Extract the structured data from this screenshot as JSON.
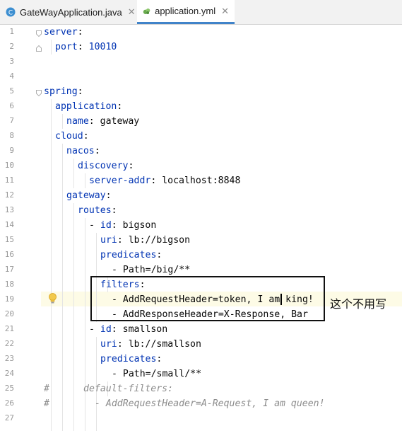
{
  "tabs": [
    {
      "label": "GateWayApplication.java",
      "icon": "java-class-icon",
      "active": false
    },
    {
      "label": "application.yml",
      "icon": "yaml-file-icon",
      "active": true
    }
  ],
  "line_numbers": [
    "1",
    "2",
    "3",
    "4",
    "5",
    "6",
    "7",
    "8",
    "9",
    "10",
    "11",
    "12",
    "13",
    "14",
    "15",
    "16",
    "17",
    "18",
    "19",
    "20",
    "21",
    "22",
    "23",
    "24",
    "25",
    "26",
    "27"
  ],
  "code": {
    "l1": {
      "key": "server",
      "sep": ":"
    },
    "l2": {
      "key": "port",
      "sep": ": ",
      "val": "10010"
    },
    "l5": {
      "key": "spring",
      "sep": ":"
    },
    "l6": {
      "key": "application",
      "sep": ":"
    },
    "l7": {
      "key": "name",
      "sep": ": ",
      "val": "gateway"
    },
    "l8": {
      "key": "cloud",
      "sep": ":"
    },
    "l9": {
      "key": "nacos",
      "sep": ":"
    },
    "l10": {
      "key": "discovery",
      "sep": ":"
    },
    "l11": {
      "key": "server-addr",
      "sep": ": ",
      "val": "localhost:8848"
    },
    "l12": {
      "key": "gateway",
      "sep": ":"
    },
    "l13": {
      "key": "routes",
      "sep": ":"
    },
    "l14": {
      "dash": "- ",
      "key": "id",
      "sep": ": ",
      "val": "bigson"
    },
    "l15": {
      "key": "uri",
      "sep": ": ",
      "val": "lb://bigson"
    },
    "l16": {
      "key": "predicates",
      "sep": ":"
    },
    "l17": {
      "dash": "- ",
      "val": "Path=/big/**"
    },
    "l18": {
      "key": "filters",
      "sep": ":"
    },
    "l19": {
      "dash": "- ",
      "val": "AddRequestHeader=token, I am king!"
    },
    "l20": {
      "dash": "- ",
      "val": "AddResponseHeader=X-Response, Bar"
    },
    "l21": {
      "dash": "- ",
      "key": "id",
      "sep": ": ",
      "val": "smallson"
    },
    "l22": {
      "key": "uri",
      "sep": ": ",
      "val": "lb://smallson"
    },
    "l23": {
      "key": "predicates",
      "sep": ":"
    },
    "l24": {
      "dash": "- ",
      "val": "Path=/small/**"
    },
    "l25": {
      "hash": "#",
      "comment": "default-filters:"
    },
    "l26": {
      "hash": "#",
      "comment": "- AddRequestHeader=A-Request, I am queen!"
    }
  },
  "annotation": "这个不用写",
  "colors": {
    "key": "#0033b3",
    "value": "#067d17",
    "comment": "#8c8c8c",
    "tab_underline": "#4083c9"
  }
}
